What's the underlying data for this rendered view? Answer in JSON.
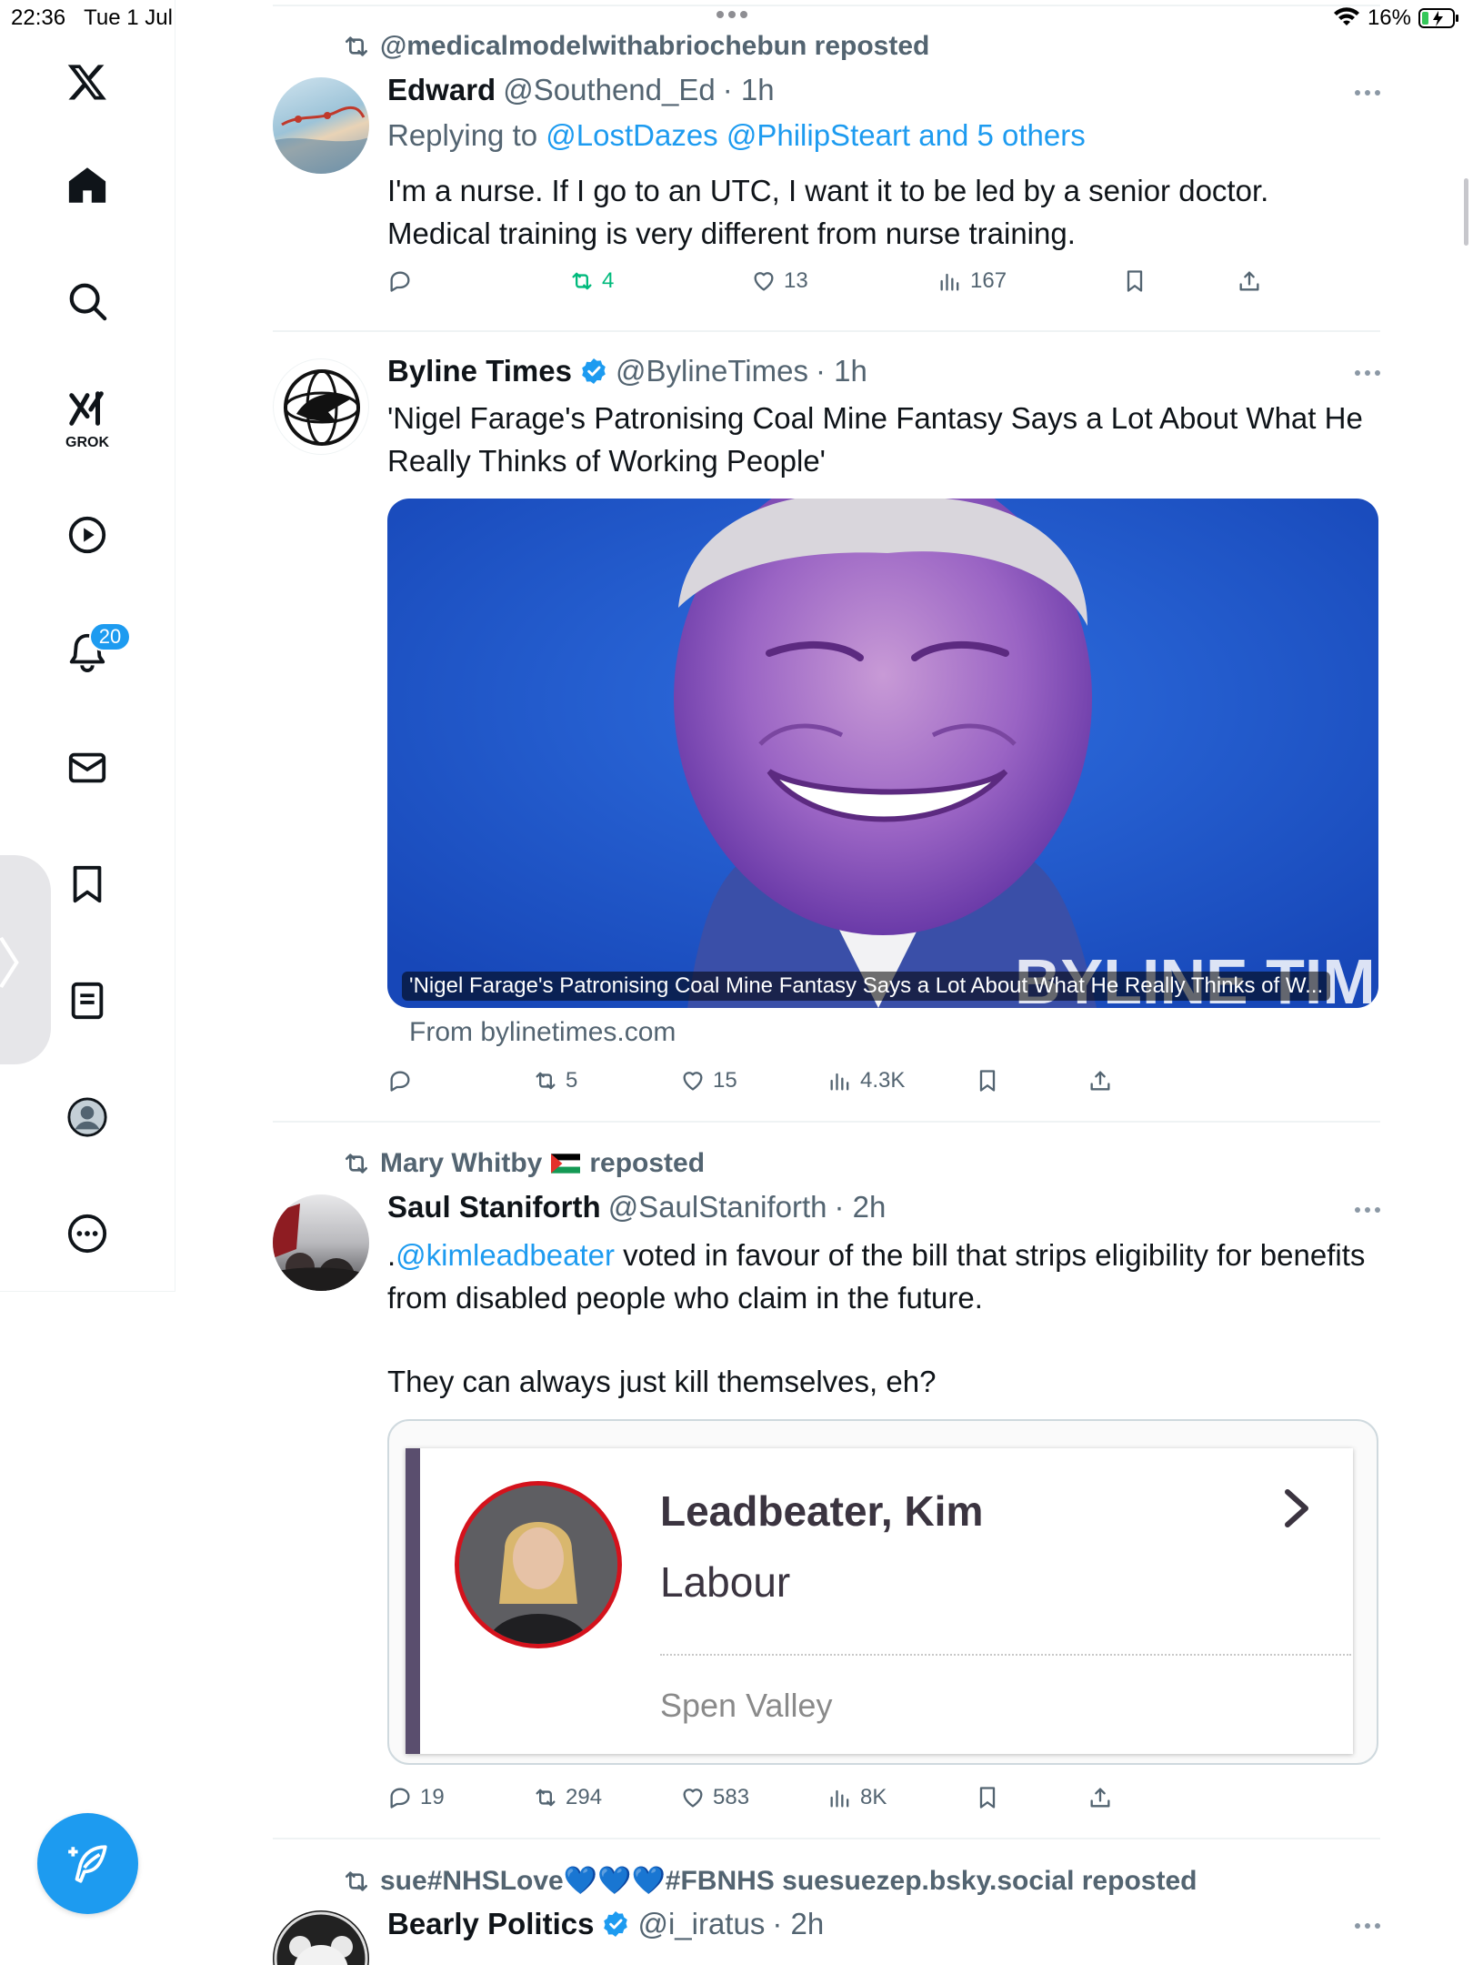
{
  "status_bar": {
    "time": "22:36",
    "date": "Tue 1 Jul",
    "battery": "16%"
  },
  "nav": {
    "notifications_badge": "20",
    "grok_label": "GROK",
    "items": [
      "x-logo-icon",
      "home-icon",
      "search-icon",
      "grok-icon",
      "video-icon",
      "notifications-icon",
      "messages-icon",
      "bookmarks-icon",
      "lists-icon",
      "profile-icon",
      "more-icon"
    ]
  },
  "tweets": [
    {
      "repost_by": "@medicalmodelwithabriochebun reposted",
      "name": "Edward",
      "handle": "@Southend_Ed",
      "time": "· 1h",
      "reply_prefix": "Replying to ",
      "reply_targets": "@LostDazes @PhilipSteart and 5 others",
      "text": "I'm a nurse. If I go to an UTC, I want it to be led by a senior doctor. Medical training is very different from nurse training.",
      "stats": {
        "replies": "",
        "reposts": "4",
        "likes": "13",
        "views": "167"
      }
    },
    {
      "name": "Byline Times",
      "handle": "@BylineTimes",
      "time": "· 1h",
      "text": "'Nigel Farage's Patronising Coal Mine Fantasy Says a Lot About What He Really Thinks of Working People'",
      "media_caption": "'Nigel Farage's Patronising Coal Mine Fantasy Says a Lot About What He Really Thinks of W...",
      "media_watermark": "BYLINE TIMES",
      "from": "From bylinetimes.com",
      "stats": {
        "replies": "",
        "reposts": "5",
        "likes": "15",
        "views": "4.3K"
      }
    },
    {
      "repost_by": "Mary Whitby",
      "repost_suffix": "reposted",
      "name": "Saul Staniforth",
      "handle": "@SaulStaniforth",
      "time": "· 2h",
      "text_prefix": ".",
      "mention": "@kimleadbeater",
      "text_rest": " voted in favour of the bill that strips eligibility for benefits from disabled people who claim in the future.",
      "text2": "They can always just kill themselves, eh?",
      "card": {
        "name": "Leadbeater, Kim",
        "party": "Labour",
        "seat": "Spen Valley"
      },
      "stats": {
        "replies": "19",
        "reposts": "294",
        "likes": "583",
        "views": "8K"
      }
    },
    {
      "repost_by": "sue#NHSLove💙💙💙#FBNHS suesuezep.bsky.social reposted",
      "name": "Bearly Politics",
      "handle": "@i_iratus",
      "time": "· 2h"
    }
  ],
  "colors": {
    "accent": "#1d9bf0",
    "repost_green": "#00ba7c",
    "secondary_text": "#536471"
  }
}
